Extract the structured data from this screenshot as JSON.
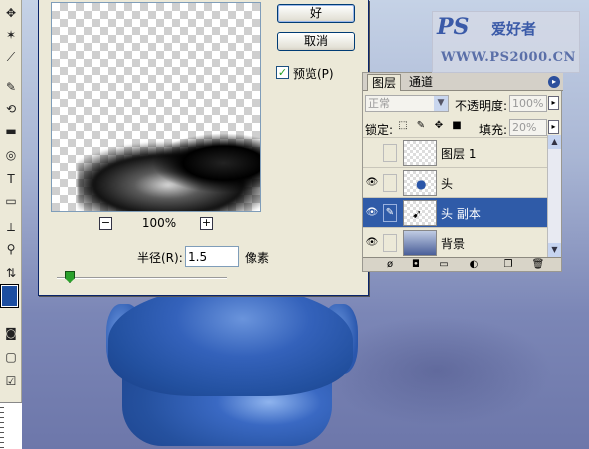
{
  "dialog": {
    "ok_label": "好",
    "cancel_label": "取消",
    "preview_label": "预览(P)",
    "preview_checked": true,
    "zoom_label": "100%",
    "zoom_minus": "−",
    "zoom_plus": "+",
    "radius_label": "半径(R):",
    "radius_value": "1.5",
    "radius_unit": "像素"
  },
  "layers_panel": {
    "tabs": [
      "图层",
      "通道"
    ],
    "blend_mode": "正常",
    "opacity_label": "不透明度:",
    "opacity_value": "100%",
    "lock_label": "锁定:",
    "fill_label": "填充:",
    "fill_value": "20%",
    "layers": [
      {
        "name": "图层 1",
        "visible": false,
        "selected": false
      },
      {
        "name": "头",
        "visible": true,
        "selected": false
      },
      {
        "name": "头 副本",
        "visible": true,
        "selected": true
      },
      {
        "name": "背景",
        "visible": true,
        "selected": false
      }
    ]
  },
  "watermark": {
    "logo": "PS",
    "tagline": "爱好者",
    "url": "WWW.PS2000.CN"
  },
  "colors": {
    "foreground": "#1c4ea0",
    "selection": "#2f5ba8"
  }
}
